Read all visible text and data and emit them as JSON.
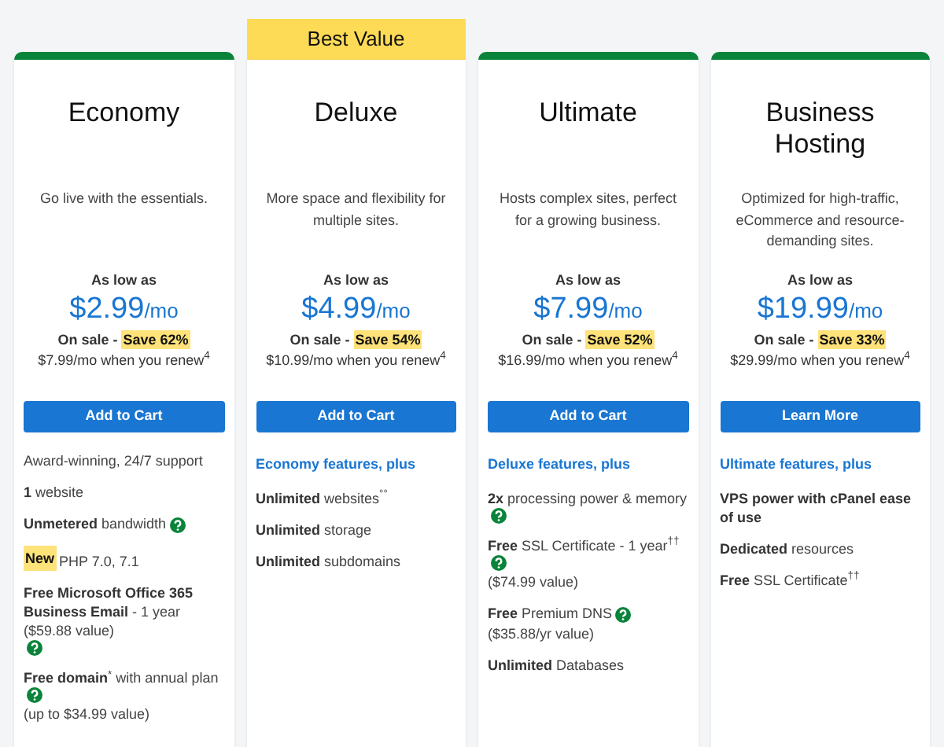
{
  "plans": [
    {
      "name": "Economy",
      "description": "Go live with the essentials.",
      "as_low_as": "As low as",
      "price": "$2.99",
      "per": "/mo",
      "on_sale": "On sale -",
      "save": "Save 62%",
      "renew": "$7.99/mo when you renew$^{4}$",
      "button": "Add to Cart",
      "features": [
        {
          "text": "Award-winning, 24/7 support",
          "help": false
        },
        {
          "text": "**1** website",
          "help": false
        },
        {
          "text": "**Unmetered** bandwidth",
          "help": true
        },
        {
          "tag": "New",
          "text": "PHP 7.0, 7.1",
          "help": false
        },
        {
          "text": "**Free Microsoft Office 365 Business Email** - 1 year ($59.88 value)",
          "help": true
        },
        {
          "text": "**Free domain**$^{*}$ with annual plan",
          "help": true,
          "note": "(up to $34.99 value)"
        }
      ]
    },
    {
      "name": "Deluxe",
      "banner": "Best Value",
      "description": "More space and flexibility for multiple sites.",
      "as_low_as": "As low as",
      "price": "$4.99",
      "per": "/mo",
      "on_sale": "On sale -",
      "save": "Save 54%",
      "renew": "$10.99/mo when you renew$^{4}$",
      "button": "Add to Cart",
      "features_heading": "Economy features, plus",
      "features": [
        {
          "text": "**Unlimited** websites$^{°°}$",
          "help": false
        },
        {
          "text": "**Unlimited** storage",
          "help": false
        },
        {
          "text": "**Unlimited** subdomains",
          "help": false
        }
      ]
    },
    {
      "name": "Ultimate",
      "description": "Hosts complex sites, perfect for a growing business.",
      "as_low_as": "As low as",
      "price": "$7.99",
      "per": "/mo",
      "on_sale": "On sale -",
      "save": "Save 52%",
      "renew": "$16.99/mo when you renew$^{4}$",
      "button": "Add to Cart",
      "features_heading": "Deluxe features, plus",
      "features": [
        {
          "text": "**2x** processing power & memory",
          "help": true
        },
        {
          "text": "**Free** SSL Certificate - 1 year$^{††}$",
          "help": true,
          "note": "($74.99 value)"
        },
        {
          "text": "**Free** Premium DNS",
          "help": true,
          "note": "($35.88/yr value)"
        },
        {
          "text": "**Unlimited** Databases",
          "help": false
        }
      ]
    },
    {
      "name": "Business Hosting",
      "description": "Optimized for high-traffic, eCommerce and resource-demanding sites.",
      "as_low_as": "As low as",
      "price": "$19.99",
      "per": "/mo",
      "on_sale": "On sale -",
      "save": "Save 33%",
      "renew": "$29.99/mo when you renew$^{4}$",
      "button": "Learn More",
      "features_heading": "Ultimate features, plus",
      "features": [
        {
          "text": "**VPS power with cPanel ease of use**",
          "help": false
        },
        {
          "text": "**Dedicated** resources",
          "help": false
        },
        {
          "text": "**Free** SSL Certificate$^{††}$",
          "help": false
        }
      ]
    }
  ]
}
